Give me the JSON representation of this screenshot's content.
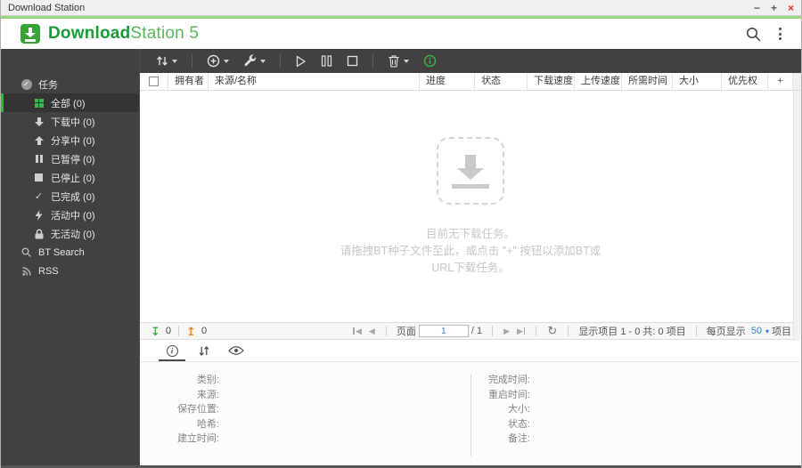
{
  "window": {
    "title": "Download Station"
  },
  "glyphs": {
    "minimize": "−",
    "maximize": "+",
    "close": "×",
    "prev": "◀",
    "next": "▶",
    "first_tri": "◀",
    "last_tri": "▶",
    "refresh": "↻",
    "down_bar_arrow": "↧",
    "up_bar_arrow": "↥",
    "check": "✓",
    "per_page_caret": "▾",
    "info_i": "i"
  },
  "header": {
    "brand_bold": "Download",
    "brand_rest": "Station 5"
  },
  "sidebar": {
    "section_label": "任务",
    "items": [
      {
        "id": "all",
        "label": "全部 (0)"
      },
      {
        "id": "downloading",
        "label": "下载中 (0)"
      },
      {
        "id": "seeding",
        "label": "分享中 (0)"
      },
      {
        "id": "paused",
        "label": "已暂停 (0)"
      },
      {
        "id": "stopped",
        "label": "已停止 (0)"
      },
      {
        "id": "completed",
        "label": "已完成 (0)"
      },
      {
        "id": "active",
        "label": "活动中 (0)"
      },
      {
        "id": "inactive",
        "label": "无活动 (0)"
      }
    ],
    "bt_search_label": "BT Search",
    "rss_label": "RSS"
  },
  "table": {
    "headers": {
      "owner": "拥有者",
      "source": "来源/名称",
      "progress": "进度",
      "status": "状态",
      "down_speed": "下载速度",
      "up_speed": "上传速度",
      "time_needed": "所需时间",
      "size": "大小",
      "priority": "优先权",
      "add_column": "+"
    }
  },
  "empty": {
    "line1": "目前无下载任务。",
    "line2": "请拖拽BT种子文件至此，或点击 \"+\" 按钮以添加BT或",
    "line3": "URL下载任务。"
  },
  "pager": {
    "down_count": "0",
    "up_count": "0",
    "page_label": "页面",
    "page_value": "1",
    "page_total": "/ 1",
    "items_info": "显示项目 1 - 0 共: 0 项目",
    "per_page_label": "每页显示",
    "per_page_value": "50",
    "per_page_suffix": "项目"
  },
  "details": {
    "left": [
      "类别:",
      "来源:",
      "保存位置:",
      "哈希:",
      "建立时间:"
    ],
    "right": [
      "完成时间:",
      "重启时间:",
      "大小:",
      "状态:",
      "备注:"
    ]
  },
  "colors": {
    "accent_green": "#3cb043",
    "upload_orange": "#f5871f",
    "link_blue": "#2f7ed8"
  }
}
